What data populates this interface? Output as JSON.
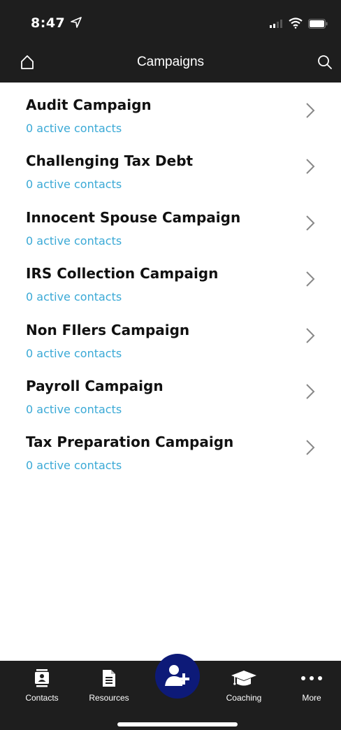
{
  "status_bar": {
    "time": "8:47"
  },
  "navbar": {
    "title": "Campaigns"
  },
  "campaigns": [
    {
      "name": "Audit Campaign",
      "contacts": "0 active contacts"
    },
    {
      "name": "Challenging Tax Debt",
      "contacts": "0 active contacts"
    },
    {
      "name": "Innocent Spouse Campaign",
      "contacts": "0 active contacts"
    },
    {
      "name": "IRS Collection Campaign",
      "contacts": "0 active contacts"
    },
    {
      "name": "Non FIlers Campaign",
      "contacts": "0 active contacts"
    },
    {
      "name": "Payroll Campaign",
      "contacts": "0 active contacts"
    },
    {
      "name": "Tax Preparation Campaign",
      "contacts": "0 active contacts"
    }
  ],
  "tabbar": {
    "contacts": "Contacts",
    "resources": "Resources",
    "coaching": "Coaching",
    "more": "More"
  },
  "icons": {
    "home": "home-icon",
    "search": "search-icon",
    "chevron": "chevron-right-icon",
    "add_contact": "add-contact-icon"
  },
  "colors": {
    "bar_background": "#1e1e1e",
    "link_blue": "#3aa9d6",
    "fab_navy": "#0d1a78"
  }
}
